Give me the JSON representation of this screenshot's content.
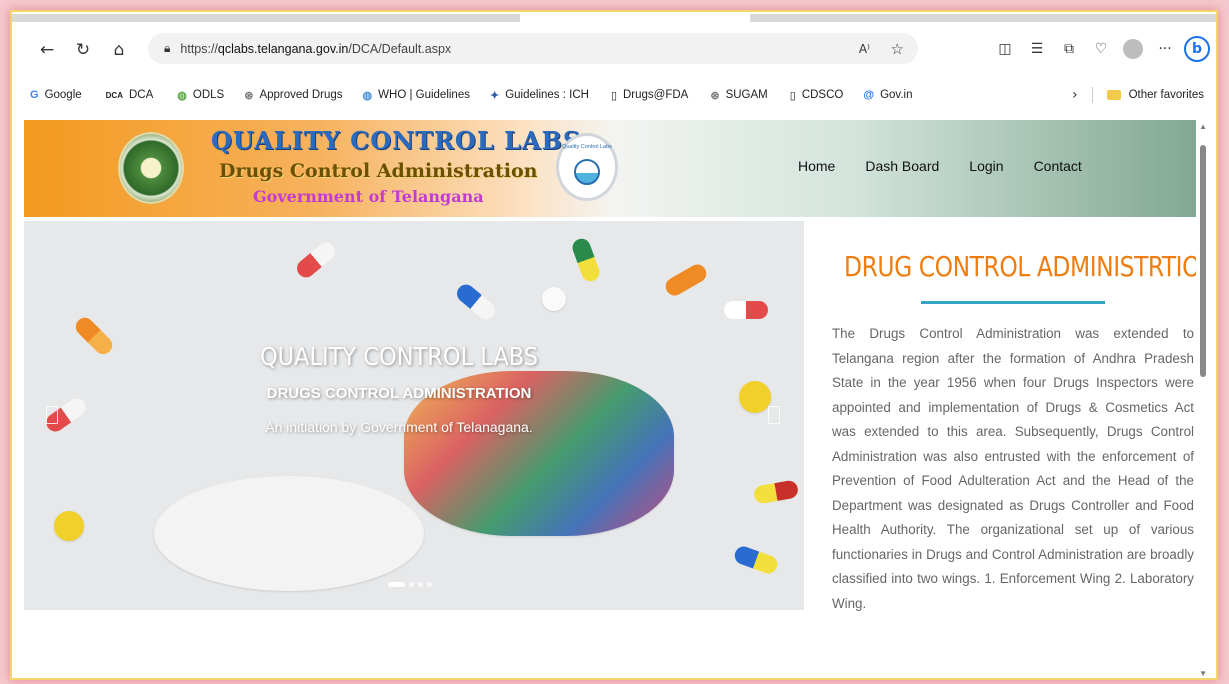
{
  "browser": {
    "url_prefix": "https://",
    "url_host": "qclabs.telangana.gov.in",
    "url_path": "/DCA/Default.aspx",
    "favorites": [
      {
        "label": "Google",
        "icon": "G"
      },
      {
        "label": "DCA",
        "icon": "DCA"
      },
      {
        "label": "ODLS",
        "icon": "◍"
      },
      {
        "label": "Approved Drugs",
        "icon": "⊛"
      },
      {
        "label": "WHO | Guidelines",
        "icon": "◍"
      },
      {
        "label": "Guidelines : ICH",
        "icon": "✦"
      },
      {
        "label": "Drugs@FDA",
        "icon": "▯"
      },
      {
        "label": "SUGAM",
        "icon": "⊛"
      },
      {
        "label": "CDSCO",
        "icon": "▯"
      },
      {
        "label": "Gov.in",
        "icon": "@"
      }
    ],
    "other_favorites": "Other favorites"
  },
  "site": {
    "title_line1": "QUALITY CONTROL LABS",
    "title_line2": "Drugs Control Administration",
    "title_line3": "Government of Telangana",
    "logo_text": "Quality Control Labs",
    "nav": [
      "Home",
      "Dash Board",
      "Login",
      "Contact"
    ]
  },
  "hero": {
    "caption_title": "QUALITY CONTROL LABS",
    "caption_subtitle": "DRUGS CONTROL ADMINISTRATION",
    "caption_text": "An initiation by Government of Telanagana.",
    "active_slide": 1,
    "slide_count": 4
  },
  "about": {
    "heading": "DRUG CONTROL ADMINISTRTION",
    "body": "The Drugs Control Administration was extended to Telangana region after the formation of Andhra Pradesh State in the year 1956 when four Drugs Inspectors were appointed and implementation of Drugs & Cosmetics Act was extended to this area. Subsequently, Drugs Control Administration was also entrusted with the enforcement of Prevention of Food Adulteration Act and the Head of the Department was designated as Drugs Controller and Food Health Authority. The organizational set up of various functionaries in Drugs and Control Administration are broadly classified into two wings. 1. Enforcement Wing 2. Laboratory Wing."
  },
  "colors": {
    "heading_orange": "#ef7d10",
    "rule_blue": "#34a3c5",
    "title_blue": "#2b6bbf",
    "title3_magenta": "#c23bd3"
  }
}
